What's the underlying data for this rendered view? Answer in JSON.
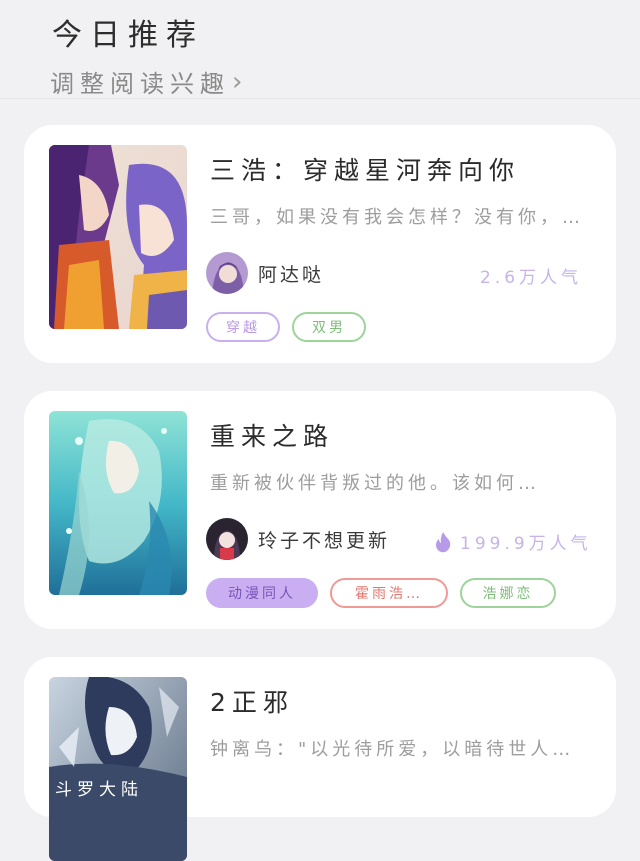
{
  "header": {
    "title": "今日推荐",
    "adjust_label": "调整阅读兴趣",
    "chevron_icon": "chevron-right-icon"
  },
  "books": [
    {
      "title": "三浩：穿越星河奔向你",
      "desc": "三哥，如果没有我会怎样？没有你，…",
      "author": "阿达哒",
      "popularity": "2.6万人气",
      "tags": [
        "穿越",
        "双男"
      ]
    },
    {
      "title": "重来之路",
      "desc": "重新被伙伴背叛过的他。该如何…",
      "author": "玲子不想更新",
      "popularity": "199.9万人气",
      "popularity_icon": "fire-icon",
      "tags": [
        "动漫同人",
        "霍雨浩…",
        "浩娜恋"
      ]
    },
    {
      "title": "2正邪",
      "desc": "钟离乌：\"以光待所爱，以暗待世人…",
      "cover_text": "斗罗大陆"
    }
  ],
  "colors": {
    "background": "#f1f1f3",
    "card": "#ffffff",
    "popularity": "#c6b4e8",
    "tag_purple": "#c9b0ec",
    "tag_green": "#9ed39a",
    "tag_red": "#ef9a94",
    "tag_filled": "#c9aef1"
  }
}
